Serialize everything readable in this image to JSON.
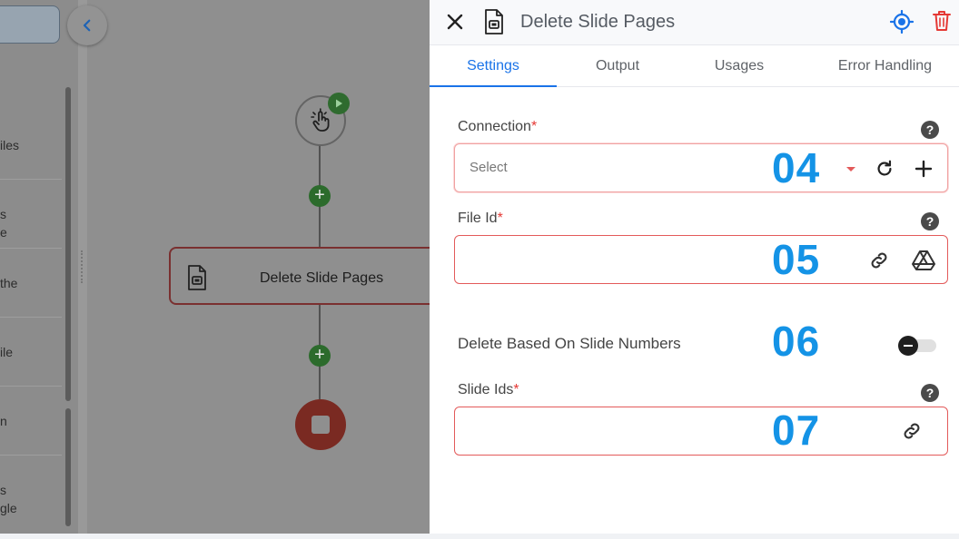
{
  "sidebar": {
    "items": [
      {
        "lines": [
          "iles"
        ]
      },
      {
        "lines": [
          "s",
          "e"
        ]
      },
      {
        "lines": [
          "the"
        ]
      },
      {
        "lines": [
          "ile"
        ]
      },
      {
        "lines": [
          "n"
        ]
      },
      {
        "lines": [
          "s",
          "gle"
        ]
      }
    ]
  },
  "flow": {
    "step_label": "Delete Slide Pages",
    "add_symbol": "+"
  },
  "panel": {
    "title": "Delete Slide Pages",
    "tabs": [
      {
        "label": "Settings",
        "active": true
      },
      {
        "label": "Output",
        "active": false
      },
      {
        "label": "Usages",
        "active": false
      },
      {
        "label": "Error Handling",
        "active": false
      }
    ],
    "help_symbol": "?",
    "required_mark": "*",
    "fields": {
      "connection": {
        "label": "Connection",
        "placeholder": "Select",
        "overlay": "04"
      },
      "file_id": {
        "label": "File Id",
        "value": "",
        "overlay": "05"
      },
      "toggle": {
        "label": "Delete Based On Slide Numbers",
        "enabled": false,
        "overlay": "06"
      },
      "slide_ids": {
        "label": "Slide Ids",
        "value": "",
        "overlay": "07"
      }
    }
  },
  "colors": {
    "accent": "#1a73e8",
    "required": "#e53935",
    "overlay_number": "#1493e6",
    "delete": "#e53935"
  }
}
